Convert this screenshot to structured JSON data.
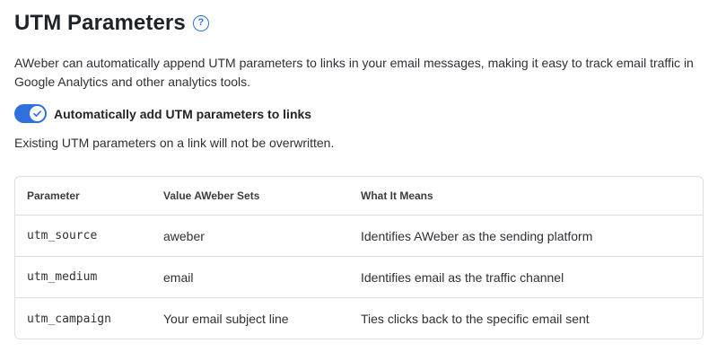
{
  "header": {
    "title": "UTM Parameters",
    "help_glyph": "?"
  },
  "description": "AWeber can automatically append UTM parameters to links in your email messages, making it easy to track email traffic in Google Analytics and other analytics tools.",
  "toggle": {
    "label": "Automatically add UTM parameters to links",
    "on": true,
    "color": "#2f6fde"
  },
  "note": "Existing UTM parameters on a link will not be overwritten.",
  "table": {
    "headers": [
      "Parameter",
      "Value AWeber Sets",
      "What It Means"
    ],
    "rows": [
      [
        "utm_source",
        "aweber",
        "Identifies AWeber as the sending platform"
      ],
      [
        "utm_medium",
        "email",
        "Identifies email as the traffic channel"
      ],
      [
        "utm_campaign",
        "Your email subject line",
        "Ties clicks back to the specific email sent"
      ]
    ]
  }
}
